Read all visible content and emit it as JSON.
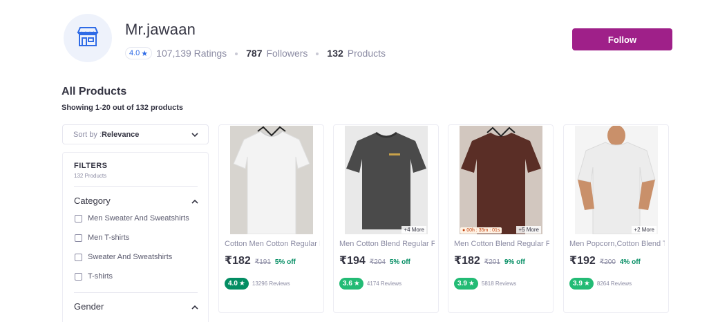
{
  "store": {
    "name": "Mr.jawaan",
    "rating": "4.0",
    "ratings_count": "107,139 Ratings",
    "followers_count": "787",
    "followers_label": "Followers",
    "products_count": "132",
    "products_label": "Products",
    "follow_label": "Follow"
  },
  "listing": {
    "title": "All Products",
    "showing": "Showing 1-20 out of 132 products"
  },
  "sort": {
    "prefix": "Sort by : ",
    "value": "Relevance"
  },
  "filters": {
    "title": "FILTERS",
    "subtitle": "132 Products",
    "category_label": "Category",
    "category_options": [
      "Men Sweater And Sweatshirts",
      "Men T-shirts",
      "Sweater And Sweatshirts",
      "T-shirts"
    ],
    "gender_label": "Gender"
  },
  "products": [
    {
      "title": "Cotton Men Cotton Regular Fit T-shirt",
      "price": "₹182",
      "mrp": "₹191",
      "off": "5% off",
      "rating": "4.0",
      "reviews": "13296 Reviews",
      "badge_color": "#038d63",
      "more": "",
      "timer": "",
      "shirt_color": "#f2f2f2"
    },
    {
      "title": "Men Cotton Blend Regular Fit T-shirt",
      "price": "₹194",
      "mrp": "₹204",
      "off": "5% off",
      "rating": "3.6",
      "reviews": "4174 Reviews",
      "badge_color": "#23bb75",
      "more": "+4 More",
      "timer": "",
      "shirt_color": "#4a4a4a"
    },
    {
      "title": "Men Cotton Blend Regular Fit T-shirt",
      "price": "₹182",
      "mrp": "₹201",
      "off": "9% off",
      "rating": "3.9",
      "reviews": "5818 Reviews",
      "badge_color": "#23bb75",
      "more": "+5 More",
      "timer": "00h : 35m : 01s",
      "shirt_color": "#5a2e26"
    },
    {
      "title": "Men Popcorn,Cotton Blend T-shirt",
      "price": "₹192",
      "mrp": "₹200",
      "off": "4% off",
      "rating": "3.9",
      "reviews": "8264 Reviews",
      "badge_color": "#23bb75",
      "more": "+2 More",
      "timer": "",
      "shirt_color": "#ececec"
    }
  ]
}
